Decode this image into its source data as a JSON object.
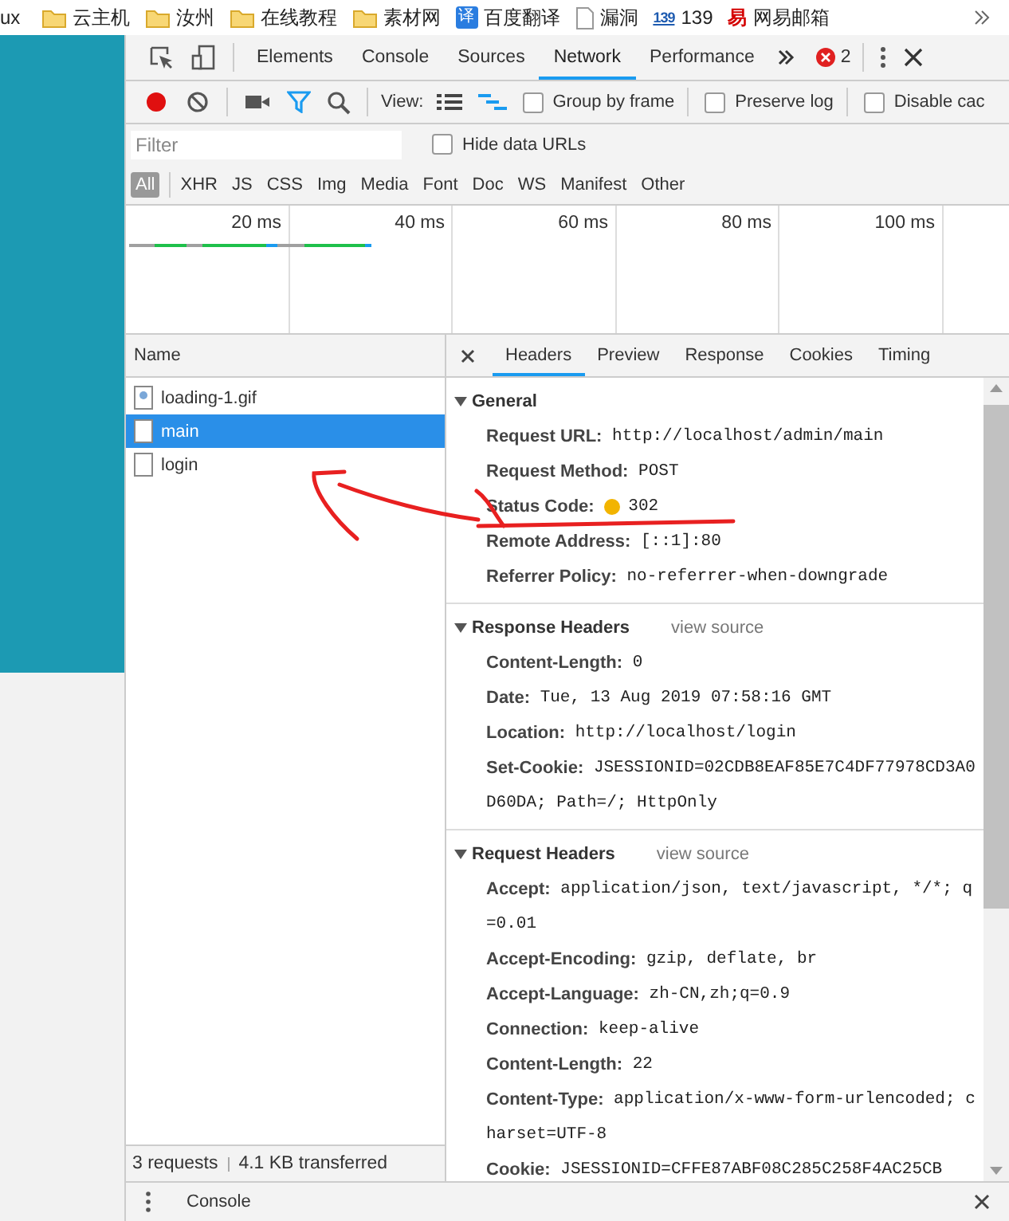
{
  "bookmarks": [
    {
      "label": "ux",
      "kind": "plain"
    },
    {
      "label": "云主机",
      "kind": "folder"
    },
    {
      "label": "汝州",
      "kind": "folder"
    },
    {
      "label": "在线教程",
      "kind": "folder"
    },
    {
      "label": "素材网",
      "kind": "folder"
    },
    {
      "label": "百度翻译",
      "kind": "badge",
      "icon_text": "译"
    },
    {
      "label": "漏洞",
      "kind": "page"
    },
    {
      "label": "139",
      "kind": "logo",
      "icon_text": "139"
    },
    {
      "label": "网易邮箱",
      "kind": "redlogo",
      "icon_text": "易"
    }
  ],
  "devtools": {
    "tabs": [
      {
        "label": "Elements",
        "selected": false
      },
      {
        "label": "Console",
        "selected": false
      },
      {
        "label": "Sources",
        "selected": false
      },
      {
        "label": "Network",
        "selected": true
      },
      {
        "label": "Performance",
        "selected": false
      }
    ],
    "error_count": "2",
    "toolbar": {
      "recording": true,
      "filter_active": true,
      "view_label": "View:",
      "view_options": [
        {
          "kind": "list",
          "selected": false
        },
        {
          "kind": "waterfall",
          "selected": true
        }
      ],
      "checkboxes": [
        {
          "label": "Group by frame",
          "checked": false
        },
        {
          "label": "Preserve log",
          "checked": false
        },
        {
          "label": "Disable cac",
          "checked": false
        }
      ]
    },
    "filter": {
      "placeholder": "Filter",
      "hide_data_urls": {
        "label": "Hide data URLs",
        "checked": false
      }
    },
    "types": [
      {
        "label": "All",
        "selected": true
      },
      {
        "label": "XHR",
        "selected": false
      },
      {
        "label": "JS",
        "selected": false
      },
      {
        "label": "CSS",
        "selected": false
      },
      {
        "label": "Img",
        "selected": false
      },
      {
        "label": "Media",
        "selected": false
      },
      {
        "label": "Font",
        "selected": false
      },
      {
        "label": "Doc",
        "selected": false
      },
      {
        "label": "WS",
        "selected": false
      },
      {
        "label": "Manifest",
        "selected": false
      },
      {
        "label": "Other",
        "selected": false
      }
    ],
    "timeline": {
      "ticks": [
        "20 ms",
        "40 ms",
        "60 ms",
        "80 ms",
        "100 ms"
      ]
    },
    "requests": {
      "column": "Name",
      "rows": [
        {
          "name": "loading-1.gif",
          "kind": "image",
          "selected": false
        },
        {
          "name": "main",
          "kind": "document",
          "selected": true
        },
        {
          "name": "login",
          "kind": "document",
          "selected": false
        }
      ]
    },
    "detail_tabs": [
      {
        "label": "Headers",
        "selected": true
      },
      {
        "label": "Preview",
        "selected": false
      },
      {
        "label": "Response",
        "selected": false
      },
      {
        "label": "Cookies",
        "selected": false
      },
      {
        "label": "Timing",
        "selected": false
      }
    ],
    "sections": [
      {
        "title": "General",
        "expanded": true,
        "rows": [
          {
            "key": "Request URL:",
            "value": "http://localhost/admin/main"
          },
          {
            "key": "Request Method:",
            "value": "POST"
          },
          {
            "key": "Status Code:",
            "value": "302",
            "color": "#f2b400"
          },
          {
            "key": "Remote Address:",
            "value": "[::1]:80"
          },
          {
            "key": "Referrer Policy:",
            "value": "no-referrer-when-downgrade"
          }
        ]
      },
      {
        "title": "Response Headers",
        "expanded": true,
        "link": "view source",
        "rows": [
          {
            "key": "Content-Length:",
            "value": "0"
          },
          {
            "key": "Date:",
            "value": "Tue, 13 Aug 2019 07:58:16 GMT"
          },
          {
            "key": "Location:",
            "value": "http://localhost/login"
          },
          {
            "key": "Set-Cookie:",
            "value": "JSESSIONID=02CDB8EAF85E7C4DF77978CD3A0D60DA; Path=/; HttpOnly"
          }
        ]
      },
      {
        "title": "Request Headers",
        "expanded": true,
        "link": "view source",
        "rows": [
          {
            "key": "Accept:",
            "value": "application/json, text/javascript, */*; q=0.01"
          },
          {
            "key": "Accept-Encoding:",
            "value": "gzip, deflate, br"
          },
          {
            "key": "Accept-Language:",
            "value": "zh-CN,zh;q=0.9"
          },
          {
            "key": "Connection:",
            "value": "keep-alive"
          },
          {
            "key": "Content-Length:",
            "value": "22"
          },
          {
            "key": "Content-Type:",
            "value": "application/x-www-form-urlencoded; charset=UTF-8"
          },
          {
            "key": "Cookie:",
            "value": "JSESSIONID=CFFE87ABF08C285C258F4AC25CB"
          }
        ]
      }
    ],
    "status_bar": {
      "requests": "3 requests",
      "transferred": "4.1 KB transferred"
    },
    "drawer": {
      "label": "Console"
    }
  }
}
